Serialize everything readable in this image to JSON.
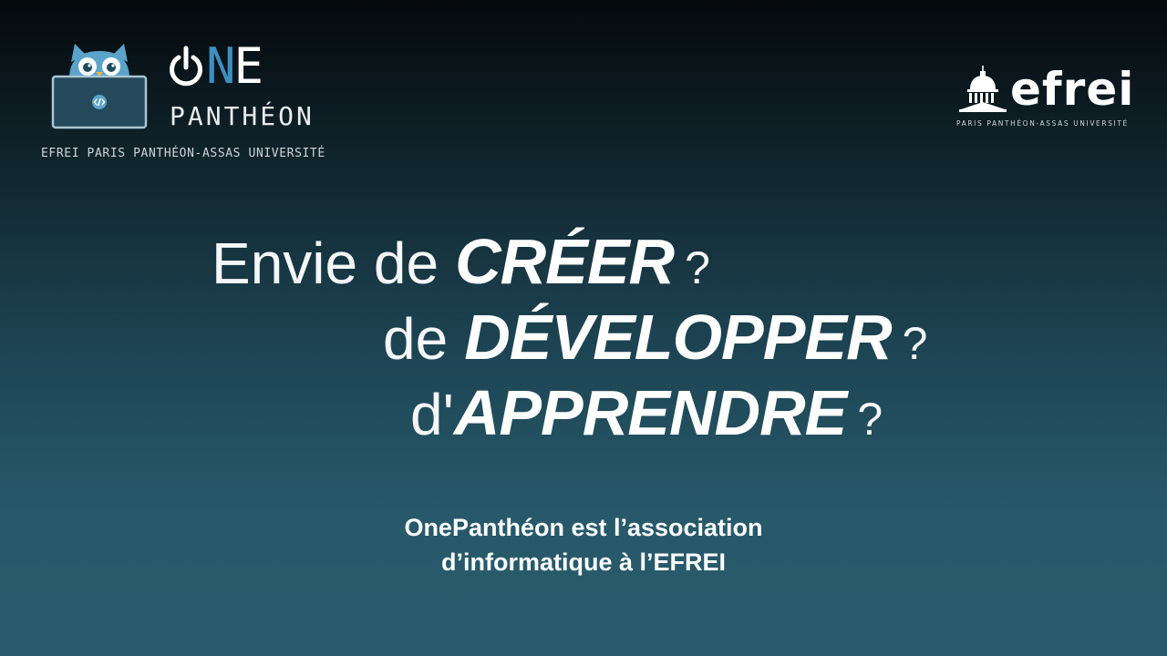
{
  "logos": {
    "onepantheon": {
      "wordmark_o": "O",
      "wordmark_n": "N",
      "wordmark_e": "E",
      "sub": "PANTHÉON",
      "tagline": "EFREI PARIS PANTHÉON-ASSAS UNIVERSITÉ",
      "owl_icon": "owl-with-laptop-icon",
      "power_icon": "power-icon"
    },
    "efrei": {
      "name": "efrei",
      "sub": "PARIS PANTHÉON-ASSAS UNIVERSITÉ",
      "dome_icon": "pantheon-dome-icon"
    }
  },
  "headline": {
    "line1": {
      "light": "Envie de",
      "bold": "CRÉER",
      "mark": "?"
    },
    "line2": {
      "light": "de",
      "bold": "DÉVELOPPER",
      "mark": "?"
    },
    "line3": {
      "light": "d'",
      "bold": "APPRENDRE",
      "mark": "?"
    }
  },
  "caption": {
    "line1": "OnePanthéon est l’association",
    "line2": "d’informatique à l’EFREI"
  },
  "colors": {
    "background_top": "#05090c",
    "background_bottom": "#285a6b",
    "accent_blue": "#3f8ec0",
    "owl_blue": "#5ba3c9"
  }
}
